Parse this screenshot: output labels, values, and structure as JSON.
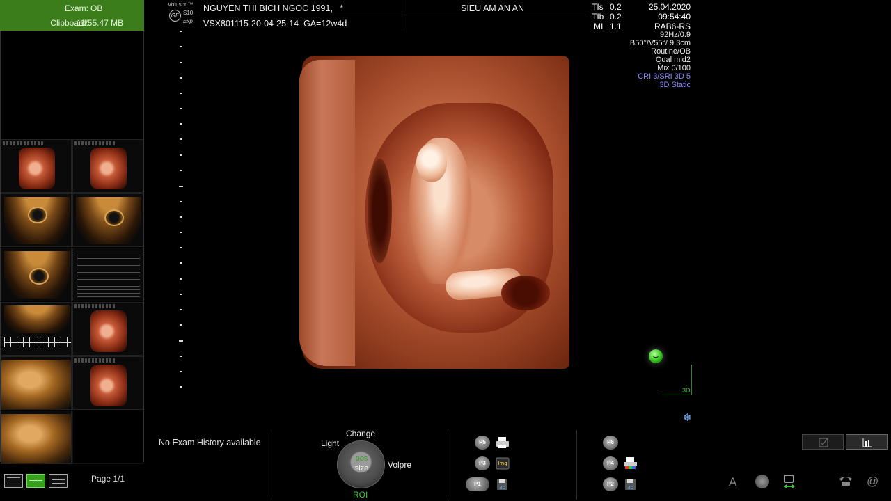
{
  "exam": {
    "exam_label": "Exam:",
    "exam_value": "OB",
    "clipboard_label": "Clipboard:",
    "clipboard_value": "11/55.47 MB"
  },
  "logo": {
    "brand": "Voluson™",
    "model": "S10",
    "suffix": "Exp",
    "ge": "GE"
  },
  "header": {
    "patient": "NGUYEN THI BICH NGOC 1991,   *",
    "exam_id": "VSX801115-20-04-25-14  GA=12w4d",
    "title": "SIEU AM AN AN",
    "tis_label": "TIs",
    "tis_value": "0.2",
    "tib_label": "TIb",
    "tib_value": "0.2",
    "mi_label": "MI",
    "mi_value": "1.1",
    "date": "25.04.2020",
    "time": "09:54:40",
    "probe": "RAB6-RS"
  },
  "params": [
    "92Hz/0.9",
    "B50°/V55°/ 9.3cm",
    "Routine/OB",
    "Qual mid2",
    "Mix 0/100"
  ],
  "params_blue": [
    "CRI 3/SRI 3D 5",
    "3D Static"
  ],
  "axis_label": "3D",
  "bottom": {
    "history": "No Exam History available",
    "knob_top": "Change",
    "knob_left": "Light",
    "knob_right": "Volpre",
    "knob_pos": "pos",
    "knob_size": "size",
    "knob_bottom": "ROI",
    "page": "Page 1/1",
    "p_buttons": [
      "P5",
      "P3",
      "P1",
      "P6",
      "P4",
      "P2"
    ]
  },
  "icons": {
    "tool1": "checkbox-icon",
    "tool2": "bar-chart-icon",
    "b1": "annotation-A-icon",
    "b2": "bodymark-icon",
    "b3": "probe-icon",
    "b4": "phone-icon",
    "b5": "at-icon"
  },
  "colors": {
    "exam_bg": "#3a7d1a",
    "accent_green": "#33a21a",
    "info_blue": "#8c8cff"
  }
}
